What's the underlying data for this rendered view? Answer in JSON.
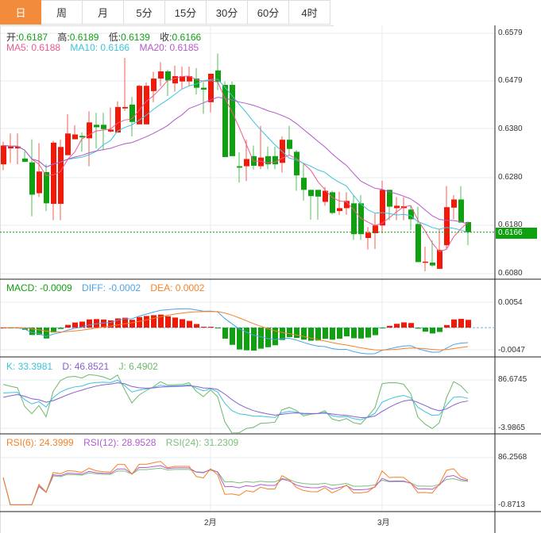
{
  "tabs": [
    {
      "label": "日",
      "active": true
    },
    {
      "label": "周"
    },
    {
      "label": "月"
    },
    {
      "label": "5分"
    },
    {
      "label": "15分"
    },
    {
      "label": "30分"
    },
    {
      "label": "60分"
    },
    {
      "label": "4时"
    }
  ],
  "ohlc_legend": {
    "open_label": "开:",
    "open": "0.6187",
    "high_label": "高:",
    "high": "0.6189",
    "low_label": "低:",
    "low": "0.6139",
    "close_label": "收:",
    "close": "0.6166"
  },
  "ma_legend": {
    "ma5": "MA5: 0.6188",
    "ma10": "MA10: 0.6166",
    "ma20": "MA20: 0.6185"
  },
  "macd_legend": {
    "macd": "MACD: -0.0009",
    "diff": "DIFF: -0.0002",
    "dea": "DEA: 0.0002"
  },
  "kdj_legend": {
    "k": "K: 33.3981",
    "d": "D: 46.8521",
    "j": "J: 6.4902"
  },
  "rsi_legend": {
    "rsi6": "RSI(6): 24.3999",
    "rsi12": "RSI(12): 28.9528",
    "rsi24": "RSI(24): 31.2309"
  },
  "price_axis": [
    "0.6579",
    "0.6479",
    "0.6380",
    "0.6280",
    "0.6180",
    "0.6080"
  ],
  "last_price": "0.6166",
  "macd_axis": [
    "0.0054",
    "-0.0047"
  ],
  "kdj_axis": [
    "86.6745",
    "-3.9865"
  ],
  "rsi_axis": [
    "86.2568",
    "-0.8713"
  ],
  "months": [
    "2月",
    "3月"
  ],
  "colors": {
    "up": "#f01a0a",
    "down": "#10a010",
    "ma5": "#ee5a8c",
    "ma10": "#3ec3dc",
    "ma20": "#b458c8",
    "diff": "#4aa3e8",
    "dea": "#f5822a",
    "k": "#3ec3dc",
    "d": "#8a5ed2",
    "j": "#6cb96c",
    "rsi6": "#f5822a",
    "rsi12": "#b45cd0",
    "rsi24": "#7cbf7c"
  },
  "chart_data": {
    "type": "candlestick",
    "ylim": [
      0.608,
      0.6579
    ],
    "candles_ohlc": [
      [
        0.6307,
        0.6354,
        0.6295,
        0.6346
      ],
      [
        0.634,
        0.6371,
        0.631,
        0.6344
      ],
      [
        0.634,
        0.6371,
        0.6307,
        0.6344
      ],
      [
        0.6319,
        0.6334,
        0.6312,
        0.6312
      ],
      [
        0.6311,
        0.6359,
        0.6199,
        0.6244
      ],
      [
        0.6247,
        0.6351,
        0.6239,
        0.6292
      ],
      [
        0.6291,
        0.6307,
        0.621,
        0.6226
      ],
      [
        0.6225,
        0.6356,
        0.6191,
        0.6352
      ],
      [
        0.6225,
        0.6358,
        0.6191,
        0.6343
      ],
      [
        0.6326,
        0.6411,
        0.6326,
        0.6371
      ],
      [
        0.6359,
        0.6388,
        0.6359,
        0.6369
      ],
      [
        0.6366,
        0.6373,
        0.6333,
        0.6363
      ],
      [
        0.6361,
        0.6417,
        0.6303,
        0.6394
      ],
      [
        0.6389,
        0.6414,
        0.634,
        0.6384
      ],
      [
        0.6389,
        0.6414,
        0.6336,
        0.638
      ],
      [
        0.6375,
        0.6425,
        0.6373,
        0.6379
      ],
      [
        0.6373,
        0.6438,
        0.6373,
        0.6426
      ],
      [
        0.6423,
        0.6528,
        0.6418,
        0.6426
      ],
      [
        0.6431,
        0.6447,
        0.6365,
        0.6395
      ],
      [
        0.639,
        0.6472,
        0.639,
        0.647
      ],
      [
        0.639,
        0.6477,
        0.639,
        0.647
      ],
      [
        0.6459,
        0.6499,
        0.6436,
        0.6485
      ],
      [
        0.6485,
        0.6519,
        0.6469,
        0.65
      ],
      [
        0.65,
        0.6503,
        0.6449,
        0.6481
      ],
      [
        0.6475,
        0.6512,
        0.6458,
        0.649
      ],
      [
        0.6479,
        0.651,
        0.6463,
        0.649
      ],
      [
        0.6479,
        0.651,
        0.6469,
        0.649
      ],
      [
        0.6485,
        0.6507,
        0.6452,
        0.6466
      ],
      [
        0.6466,
        0.6478,
        0.6412,
        0.6462
      ],
      [
        0.6436,
        0.6495,
        0.6415,
        0.6495
      ],
      [
        0.6502,
        0.6537,
        0.6461,
        0.6478
      ],
      [
        0.6472,
        0.6479,
        0.6322,
        0.6322
      ],
      [
        0.6472,
        0.6479,
        0.6324,
        0.6324
      ],
      [
        0.6303,
        0.6332,
        0.6269,
        0.63
      ],
      [
        0.6303,
        0.6358,
        0.6272,
        0.6318
      ],
      [
        0.6324,
        0.6346,
        0.6296,
        0.6304
      ],
      [
        0.6303,
        0.6387,
        0.6297,
        0.6321
      ],
      [
        0.6324,
        0.6344,
        0.6297,
        0.6307
      ],
      [
        0.6324,
        0.6344,
        0.6297,
        0.6307
      ],
      [
        0.631,
        0.6365,
        0.629,
        0.6358
      ],
      [
        0.6358,
        0.6387,
        0.6325,
        0.6339
      ],
      [
        0.6333,
        0.6337,
        0.6252,
        0.6284
      ],
      [
        0.6279,
        0.6307,
        0.6232,
        0.6254
      ],
      [
        0.6254,
        0.6254,
        0.6192,
        0.6241
      ],
      [
        0.6254,
        0.6254,
        0.6192,
        0.624
      ],
      [
        0.6229,
        0.626,
        0.6221,
        0.6252
      ],
      [
        0.6249,
        0.6252,
        0.6203,
        0.6206
      ],
      [
        0.621,
        0.625,
        0.6202,
        0.6216
      ],
      [
        0.6216,
        0.6249,
        0.6202,
        0.6231
      ],
      [
        0.6226,
        0.6243,
        0.615,
        0.6162
      ],
      [
        0.6226,
        0.6243,
        0.615,
        0.6162
      ],
      [
        0.6154,
        0.6177,
        0.613,
        0.6165
      ],
      [
        0.6164,
        0.6205,
        0.6131,
        0.618
      ],
      [
        0.618,
        0.6273,
        0.6164,
        0.6254
      ],
      [
        0.6254,
        0.6254,
        0.6191,
        0.6219
      ],
      [
        0.6216,
        0.6239,
        0.6191,
        0.6221
      ],
      [
        0.6216,
        0.6239,
        0.6191,
        0.622
      ],
      [
        0.6213,
        0.6222,
        0.617,
        0.6193
      ],
      [
        0.6183,
        0.6219,
        0.6104,
        0.6104
      ],
      [
        0.6103,
        0.6136,
        0.6085,
        0.6105
      ],
      [
        0.6103,
        0.6149,
        0.6094,
        0.6097
      ],
      [
        0.609,
        0.6173,
        0.609,
        0.6129
      ],
      [
        0.6139,
        0.6262,
        0.6132,
        0.6218
      ],
      [
        0.6217,
        0.6243,
        0.6193,
        0.6234
      ],
      [
        0.6234,
        0.6262,
        0.6186,
        0.6186
      ],
      [
        0.6187,
        0.6189,
        0.6139,
        0.6166
      ]
    ],
    "macd_range": [
      -0.0047,
      0.0054
    ],
    "kdj_range": [
      -3.9865,
      86.6745
    ],
    "rsi_range": [
      -0.8713,
      86.2568
    ],
    "month_labels": [
      "2月",
      "3月"
    ]
  }
}
